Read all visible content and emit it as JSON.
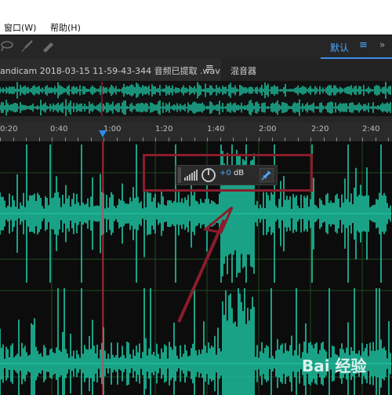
{
  "menu": {
    "window_label": "窗口(W)",
    "help_label": "帮助(H)"
  },
  "toolbar": {
    "workspace_label": "默认",
    "tool_icons": [
      "lasso-icon",
      "brush-icon",
      "spot-healing-icon"
    ],
    "accent_color": "#3b8ee8"
  },
  "tabs": {
    "file_tab_label": "andicam 2018-03-15 11-59-43-344 音频已提取 .wav",
    "mixer_tab_label": "混音器"
  },
  "ruler": {
    "labels": [
      "0:20",
      "0:40",
      "1:00",
      "1:20",
      "1:40",
      "2:00",
      "2:20",
      "2:40"
    ]
  },
  "hud": {
    "volume_value": "+0",
    "volume_unit": "dB"
  },
  "waveform": {
    "color": "#1ec9a6",
    "playhead_color": "#e0203a"
  },
  "watermark": {
    "text": "Bai 经验"
  }
}
